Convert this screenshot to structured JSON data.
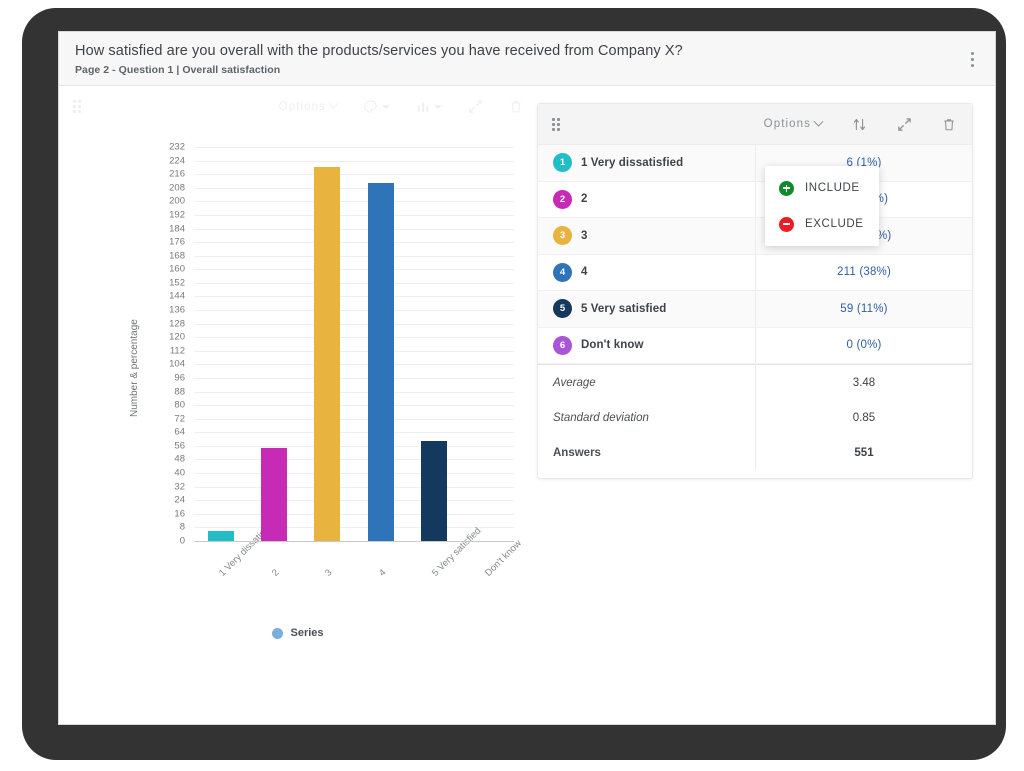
{
  "header": {
    "title": "How satisfied are you overall with the products/services you have received from Company X?",
    "subtitle": "Page 2 - Question 1 | Overall satisfaction",
    "menu_icon": "more-vertical-icon"
  },
  "chart_toolbar": {
    "drag_handle": "drag-handle-icon",
    "options_label": "Options",
    "palette_icon": "palette-icon",
    "chart_type_icon": "bar-chart-icon",
    "expand_icon": "expand-icon",
    "delete_icon": "trash-icon"
  },
  "table_toolbar": {
    "drag_handle": "drag-handle-icon",
    "options_label": "Options",
    "sort_icon": "sort-icon",
    "expand_icon": "expand-icon",
    "delete_icon": "trash-icon"
  },
  "context_menu": {
    "items": [
      {
        "label": "INCLUDE",
        "icon": "include-plus-icon",
        "color": "#0f8a2e"
      },
      {
        "label": "EXCLUDE",
        "icon": "exclude-minus-icon",
        "color": "#ec1c24"
      }
    ]
  },
  "table": {
    "rows": [
      {
        "num": "1",
        "label": "1 Very dissatisfied",
        "value": "6 (1%)",
        "color": "#22bec8"
      },
      {
        "num": "2",
        "label": "2",
        "value": "55 (10%)",
        "color": "#c72ab5"
      },
      {
        "num": "3",
        "label": "3",
        "value": "220 (40%)",
        "color": "#e8b33f"
      },
      {
        "num": "4",
        "label": "4",
        "value": "211 (38%)",
        "color": "#2f73b8"
      },
      {
        "num": "5",
        "label": "5 Very satisfied",
        "value": "59 (11%)",
        "color": "#15385e"
      },
      {
        "num": "6",
        "label": "Don't know",
        "value": "0 (0%)",
        "color": "#a855d6"
      }
    ],
    "stats": [
      {
        "label": "Average",
        "value": "3.48"
      },
      {
        "label": "Standard deviation",
        "value": "0.85"
      },
      {
        "label": "Answers",
        "value": "551"
      }
    ]
  },
  "chart_data": {
    "type": "bar",
    "title": "",
    "xlabel": "",
    "ylabel": "Number & percentage",
    "categories": [
      "1 Very dissatisfied",
      "2",
      "3",
      "4",
      "5 Very satisfied",
      "Don't know"
    ],
    "values": [
      6,
      55,
      220,
      211,
      59,
      0
    ],
    "colors": [
      "#22bec8",
      "#c72ab5",
      "#e8b33f",
      "#2f73b8",
      "#15385e",
      "#a855d6"
    ],
    "ylim": [
      0,
      232
    ],
    "ytick_step": 8,
    "yticks": [
      232,
      224,
      216,
      208,
      200,
      192,
      184,
      176,
      168,
      160,
      152,
      144,
      136,
      128,
      120,
      112,
      104,
      96,
      88,
      80,
      72,
      64,
      56,
      48,
      40,
      32,
      24,
      16,
      8,
      0
    ],
    "grid": true,
    "legend": {
      "position": "bottom",
      "entries": [
        "Series"
      ],
      "swatch_color": "#7aaedd"
    }
  }
}
